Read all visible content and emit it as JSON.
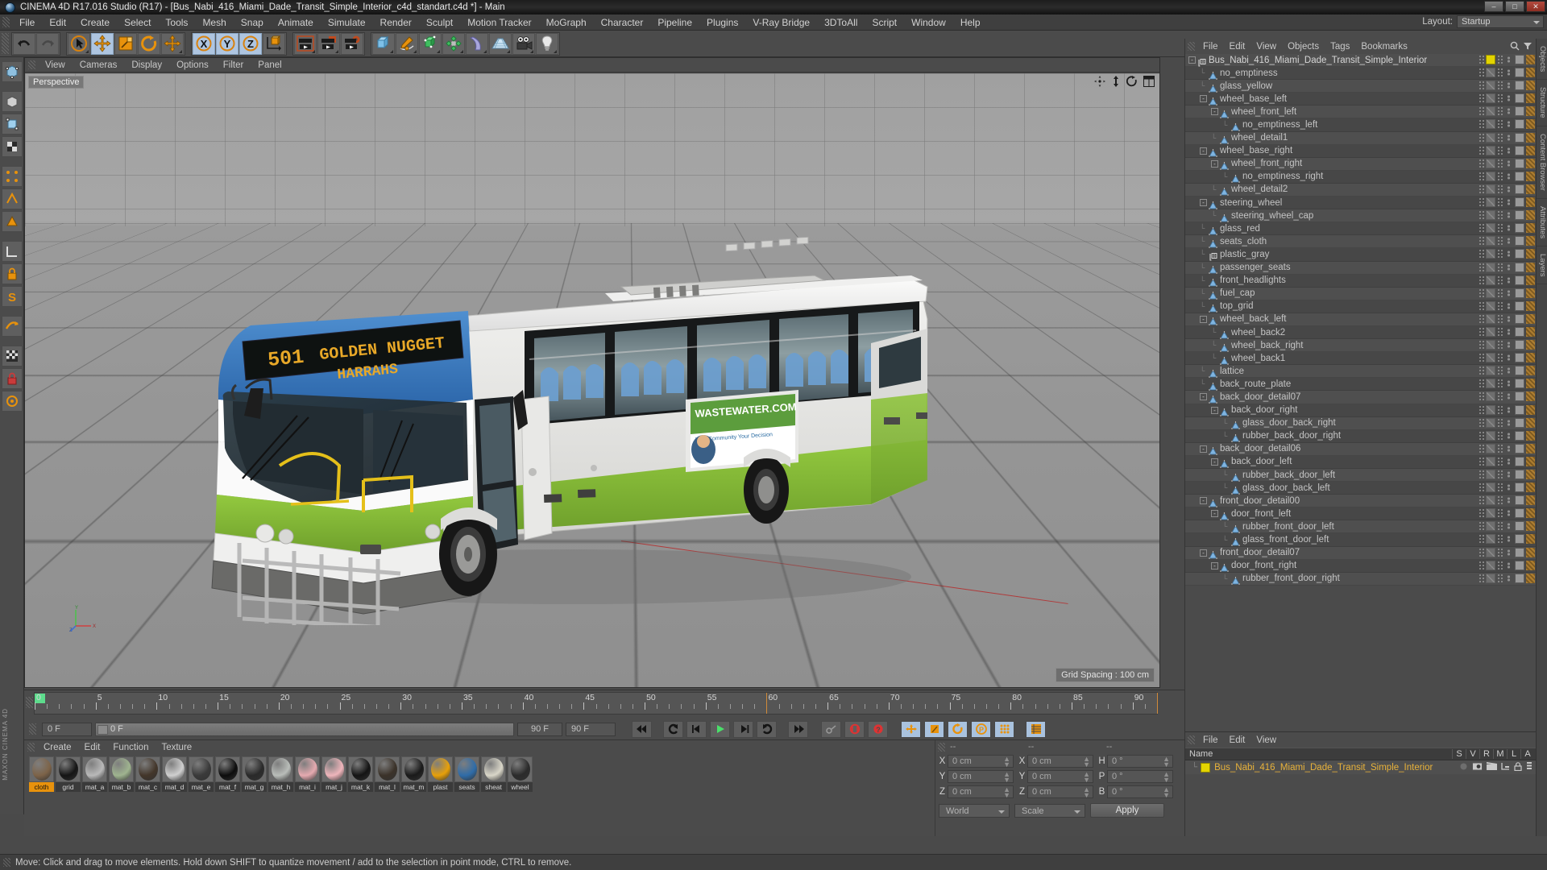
{
  "window": {
    "title": "CINEMA 4D R17.016 Studio (R17) - [Bus_Nabi_416_Miami_Dade_Transit_Simple_Interior_c4d_standart.c4d *] - Main",
    "minimize": "–",
    "maximize": "□",
    "close": "✕"
  },
  "menubar": {
    "items": [
      "File",
      "Edit",
      "Create",
      "Select",
      "Tools",
      "Mesh",
      "Snap",
      "Animate",
      "Simulate",
      "Render",
      "Sculpt",
      "Motion Tracker",
      "MoGraph",
      "Character",
      "Pipeline",
      "Plugins",
      "V-Ray Bridge",
      "3DToAll",
      "Script",
      "Window",
      "Help"
    ],
    "layout_label": "Layout:",
    "layout_value": "Startup"
  },
  "viewport": {
    "menu": [
      "View",
      "Cameras",
      "Display",
      "Options",
      "Filter",
      "Panel"
    ],
    "camera_label": "Perspective",
    "grid_spacing": "Grid Spacing : 100 cm",
    "bus_sign_route": "501",
    "bus_sign_line1": "GOLDEN NUGGET",
    "bus_sign_line2": "HARRAHS",
    "ad_text": "WASTEWATER.COM"
  },
  "timeline": {
    "ticks": [
      "0",
      "5",
      "10",
      "15",
      "20",
      "25",
      "30",
      "35",
      "40",
      "45",
      "50",
      "55",
      "60",
      "65",
      "70",
      "75",
      "80",
      "85",
      "90"
    ],
    "current_frame": "0 F",
    "start_frame": "0 F",
    "end_frame": "90 F",
    "preview_end": "90 F",
    "range_end": "90 F"
  },
  "materials": {
    "menu": [
      "Create",
      "Edit",
      "Function",
      "Texture"
    ],
    "items": [
      {
        "name": "cloth",
        "color": "#7d6348",
        "selected": true
      },
      {
        "name": "grid",
        "color": "#151515",
        "selected": false
      },
      {
        "name": "mat_a",
        "color": "#b9b9b9",
        "selected": false
      },
      {
        "name": "mat_b",
        "color": "#9fb48f",
        "selected": false
      },
      {
        "name": "mat_c",
        "color": "#43362a",
        "selected": false
      },
      {
        "name": "mat_d",
        "color": "#cfcfcf",
        "selected": false
      },
      {
        "name": "mat_e",
        "color": "#3a3a3a",
        "selected": false
      },
      {
        "name": "mat_f",
        "color": "#0d0d0d",
        "selected": false
      },
      {
        "name": "mat_g",
        "color": "#2a2a2a",
        "selected": false
      },
      {
        "name": "mat_h",
        "color": "#b9bdb9",
        "selected": false
      },
      {
        "name": "mat_i",
        "color": "#e5aab0",
        "selected": false
      },
      {
        "name": "mat_j",
        "color": "#efb5bb",
        "selected": false
      },
      {
        "name": "mat_k",
        "color": "#141414",
        "selected": false
      },
      {
        "name": "mat_l",
        "color": "#3b3229",
        "selected": false
      },
      {
        "name": "mat_m",
        "color": "#1a1a1a",
        "selected": false
      },
      {
        "name": "plast",
        "color": "#e7a009",
        "selected": false
      },
      {
        "name": "seats",
        "color": "#2f6ca8",
        "selected": false
      },
      {
        "name": "sheat",
        "color": "#d9d6c8",
        "selected": false
      },
      {
        "name": "wheel",
        "color": "#2b2b2b",
        "selected": false
      }
    ]
  },
  "coordinates": {
    "header": [
      "--",
      "--",
      "--"
    ],
    "rows": [
      {
        "pos_label": "X",
        "pos_value": "0 cm",
        "size_label": "X",
        "size_value": "0 cm",
        "rot_label": "H",
        "rot_value": "0 °"
      },
      {
        "pos_label": "Y",
        "pos_value": "0 cm",
        "size_label": "Y",
        "size_value": "0 cm",
        "rot_label": "P",
        "rot_value": "0 °"
      },
      {
        "pos_label": "Z",
        "pos_value": "0 cm",
        "size_label": "Z",
        "size_value": "0 cm",
        "rot_label": "B",
        "rot_value": "0 °"
      }
    ],
    "system": "World",
    "mode": "Scale",
    "apply": "Apply"
  },
  "object_manager": {
    "menu": [
      "File",
      "Edit",
      "View",
      "Objects",
      "Tags",
      "Bookmarks"
    ],
    "tree": [
      {
        "label": "Bus_Nabi_416_Miami_Dade_Transit_Simple_Interior",
        "depth": 0,
        "icon": "null-object",
        "expander": "-",
        "tag": "yellow"
      },
      {
        "label": "no_emptiness",
        "depth": 1,
        "icon": "polygon-object",
        "expander": "",
        "tag": "img"
      },
      {
        "label": "glass_yellow",
        "depth": 1,
        "icon": "polygon-object",
        "expander": "",
        "tag": "img"
      },
      {
        "label": "wheel_base_left",
        "depth": 1,
        "icon": "polygon-object",
        "expander": "-",
        "tag": "img"
      },
      {
        "label": "wheel_front_left",
        "depth": 2,
        "icon": "polygon-object",
        "expander": "-",
        "tag": "img"
      },
      {
        "label": "no_emptiness_left",
        "depth": 3,
        "icon": "polygon-object",
        "expander": "",
        "tag": "img"
      },
      {
        "label": "wheel_detail1",
        "depth": 2,
        "icon": "polygon-object",
        "expander": "",
        "tag": "img"
      },
      {
        "label": "wheel_base_right",
        "depth": 1,
        "icon": "polygon-object",
        "expander": "-",
        "tag": "img"
      },
      {
        "label": "wheel_front_right",
        "depth": 2,
        "icon": "polygon-object",
        "expander": "-",
        "tag": "img"
      },
      {
        "label": "no_emptiness_right",
        "depth": 3,
        "icon": "polygon-object",
        "expander": "",
        "tag": "img"
      },
      {
        "label": "wheel_detail2",
        "depth": 2,
        "icon": "polygon-object",
        "expander": "",
        "tag": "img"
      },
      {
        "label": "steering_wheel",
        "depth": 1,
        "icon": "polygon-object",
        "expander": "-",
        "tag": "img"
      },
      {
        "label": "steering_wheel_cap",
        "depth": 2,
        "icon": "polygon-object",
        "expander": "",
        "tag": "img"
      },
      {
        "label": "glass_red",
        "depth": 1,
        "icon": "polygon-object",
        "expander": "",
        "tag": "img"
      },
      {
        "label": "seats_cloth",
        "depth": 1,
        "icon": "polygon-object",
        "expander": "",
        "tag": "img"
      },
      {
        "label": "plastic_gray",
        "depth": 1,
        "icon": "null-object",
        "expander": "",
        "tag": "img"
      },
      {
        "label": "passenger_seats",
        "depth": 1,
        "icon": "polygon-object",
        "expander": "",
        "tag": "img"
      },
      {
        "label": "front_headlights",
        "depth": 1,
        "icon": "polygon-object",
        "expander": "",
        "tag": "img"
      },
      {
        "label": "fuel_cap",
        "depth": 1,
        "icon": "polygon-object",
        "expander": "",
        "tag": "img"
      },
      {
        "label": "top_grid",
        "depth": 1,
        "icon": "polygon-object",
        "expander": "",
        "tag": "img"
      },
      {
        "label": "wheel_back_left",
        "depth": 1,
        "icon": "polygon-object",
        "expander": "-",
        "tag": "img"
      },
      {
        "label": "wheel_back2",
        "depth": 2,
        "icon": "polygon-object",
        "expander": "",
        "tag": "img"
      },
      {
        "label": "wheel_back_right",
        "depth": 2,
        "icon": "polygon-object",
        "expander": "",
        "tag": "img"
      },
      {
        "label": "wheel_back1",
        "depth": 2,
        "icon": "polygon-object",
        "expander": "",
        "tag": "img"
      },
      {
        "label": "lattice",
        "depth": 1,
        "icon": "polygon-object",
        "expander": "",
        "tag": "img"
      },
      {
        "label": "back_route_plate",
        "depth": 1,
        "icon": "polygon-object",
        "expander": "",
        "tag": "img"
      },
      {
        "label": "back_door_detail07",
        "depth": 1,
        "icon": "polygon-object",
        "expander": "-",
        "tag": "img"
      },
      {
        "label": "back_door_right",
        "depth": 2,
        "icon": "polygon-object",
        "expander": "-",
        "tag": "img"
      },
      {
        "label": "glass_door_back_right",
        "depth": 3,
        "icon": "polygon-object",
        "expander": "",
        "tag": "img"
      },
      {
        "label": "rubber_back_door_right",
        "depth": 3,
        "icon": "polygon-object",
        "expander": "",
        "tag": "img"
      },
      {
        "label": "back_door_detail06",
        "depth": 1,
        "icon": "polygon-object",
        "expander": "-",
        "tag": "img"
      },
      {
        "label": "back_door_left",
        "depth": 2,
        "icon": "polygon-object",
        "expander": "-",
        "tag": "img"
      },
      {
        "label": "rubber_back_door_left",
        "depth": 3,
        "icon": "polygon-object",
        "expander": "",
        "tag": "img"
      },
      {
        "label": "glass_door_back_left",
        "depth": 3,
        "icon": "polygon-object",
        "expander": "",
        "tag": "img"
      },
      {
        "label": "front_door_detail00",
        "depth": 1,
        "icon": "polygon-object",
        "expander": "-",
        "tag": "img"
      },
      {
        "label": "door_front_left",
        "depth": 2,
        "icon": "polygon-object",
        "expander": "-",
        "tag": "img"
      },
      {
        "label": "rubber_front_door_left",
        "depth": 3,
        "icon": "polygon-object",
        "expander": "",
        "tag": "img"
      },
      {
        "label": "glass_front_door_left",
        "depth": 3,
        "icon": "polygon-object",
        "expander": "",
        "tag": "img"
      },
      {
        "label": "front_door_detail07",
        "depth": 1,
        "icon": "polygon-object",
        "expander": "-",
        "tag": "img"
      },
      {
        "label": "door_front_right",
        "depth": 2,
        "icon": "polygon-object",
        "expander": "-",
        "tag": "img"
      },
      {
        "label": "rubber_front_door_right",
        "depth": 3,
        "icon": "polygon-object",
        "expander": "",
        "tag": "img"
      }
    ]
  },
  "object_manager_bottom": {
    "menu": [
      "File",
      "Edit",
      "View"
    ],
    "name_header": "Name",
    "columns": [
      "S",
      "V",
      "R",
      "M",
      "L",
      "A"
    ],
    "row_label": "Bus_Nabi_416_Miami_Dade_Transit_Simple_Interior"
  },
  "right_tabs": [
    "Objects",
    "Structure",
    "Content Browser",
    "Attributes",
    "Layers"
  ],
  "status": {
    "message": "Move: Click and drag to move elements. Hold down SHIFT to quantize movement / add to the selection in point mode, CTRL to remove."
  },
  "colors": {
    "accent_orange": "#e8920c",
    "selection_blue": "#aec5e0",
    "bus_blue": "#2f6fb5",
    "bus_green": "#86bc36",
    "bus_white": "#e6e6e6",
    "tree_text": "#c4c4c4",
    "object_name": "#e8b23a"
  }
}
